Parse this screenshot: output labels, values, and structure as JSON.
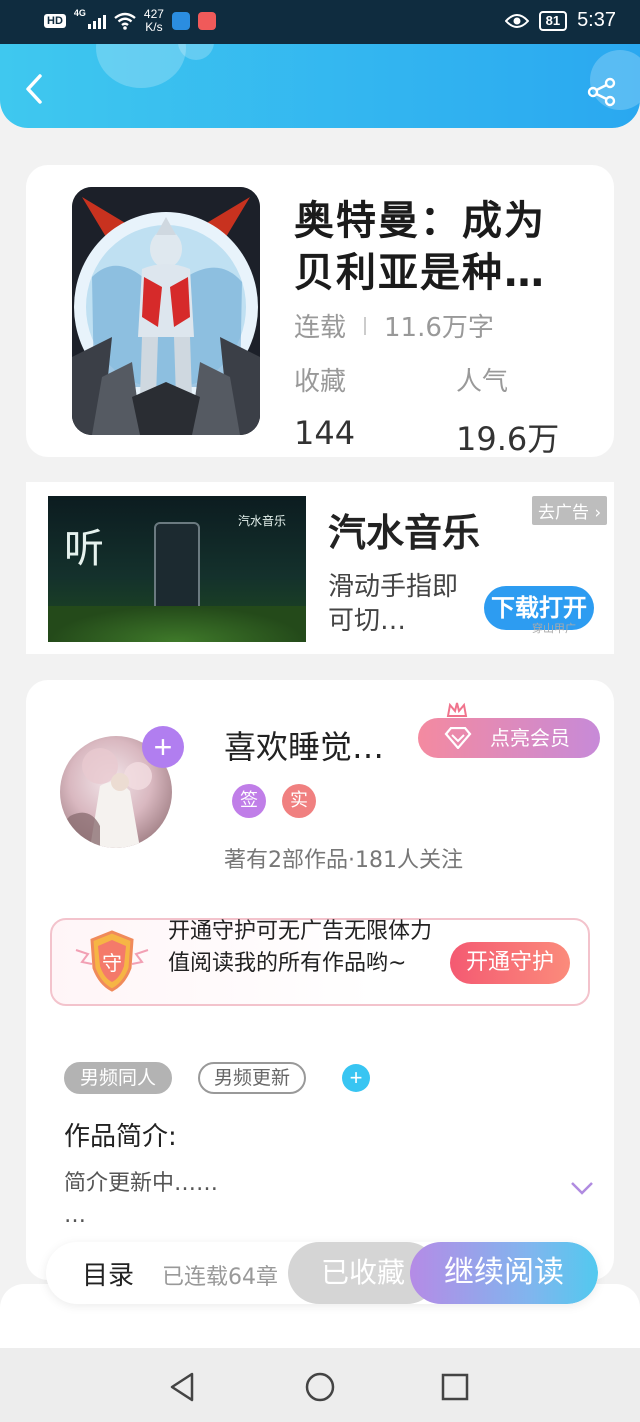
{
  "status_bar": {
    "hd": "HD",
    "network": "4G",
    "speed_value": "427",
    "speed_unit": "K/s",
    "battery": "81",
    "time": "5:37"
  },
  "book": {
    "title": "奥特曼：成为贝利亚是种…",
    "status": "连载",
    "word_count": "11.6万字",
    "favorites_label": "收藏",
    "favorites_value": "144",
    "popularity_label": "人气",
    "popularity_value": "19.6万"
  },
  "ad": {
    "image_text_big": "听",
    "image_brand": "汽水音乐",
    "title": "汽水音乐",
    "description": "滑动手指即可切…",
    "close_label": "去广告",
    "action_label": "下载打开",
    "tiny_text": "穿山甲广"
  },
  "author": {
    "name": "喜欢睡觉…",
    "vip_label": "点亮会员",
    "badge_sign": "签",
    "badge_real": "实",
    "stats": "著有2部作品·181人关注"
  },
  "guard": {
    "shield_text": "守",
    "text": "开通守护可无广告无限体力值阅读我的所有作品哟~",
    "button": "开通守护"
  },
  "tags": [
    "男频同人",
    "男频更新"
  ],
  "intro": {
    "title": "作品简介:",
    "text": "简介更新中……",
    "ellipsis": "…"
  },
  "bottom": {
    "toc": "目录",
    "serial": "已连载64章",
    "favorited": "已收藏",
    "continue": "继续阅读"
  },
  "colors": {
    "header_start": "#3fc8ef",
    "header_end": "#2aa8f0",
    "accent_purple": "#b17ef0",
    "accent_pink": "#f45a72",
    "ad_button": "#2d9cf1"
  },
  "icons": [
    "back-icon",
    "share-icon",
    "plus-icon",
    "crown-icon",
    "diamond-icon",
    "shield-icon",
    "chevron-down-icon",
    "nav-back-icon",
    "nav-home-icon",
    "nav-recent-icon"
  ]
}
